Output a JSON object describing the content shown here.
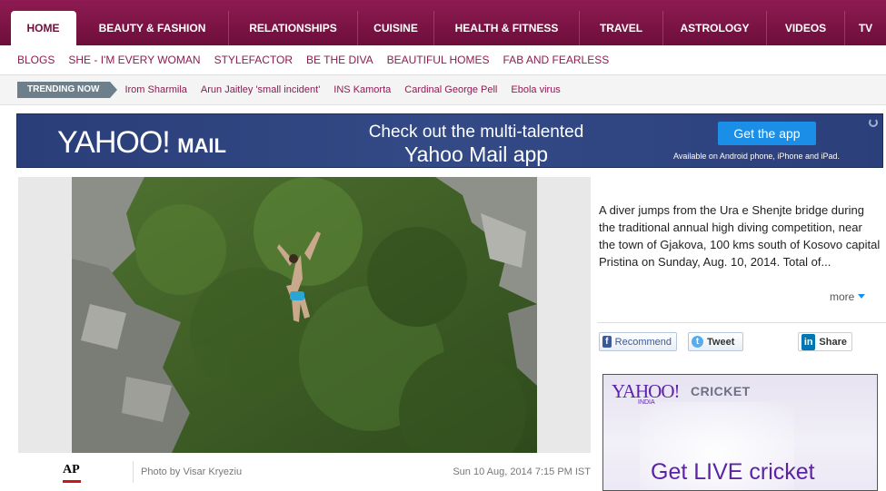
{
  "nav": {
    "tabs": [
      {
        "label": "HOME"
      },
      {
        "label": "BEAUTY & FASHION"
      },
      {
        "label": "RELATIONSHIPS"
      },
      {
        "label": "CUISINE"
      },
      {
        "label": "HEALTH & FITNESS"
      },
      {
        "label": "TRAVEL"
      },
      {
        "label": "ASTROLOGY"
      },
      {
        "label": "VIDEOS"
      },
      {
        "label": "TV"
      }
    ],
    "subnav": [
      "BLOGS",
      "SHE - I'M EVERY WOMAN",
      "STYLEFACTOR",
      "BE THE DIVA",
      "BEAUTIFUL HOMES",
      "FAB AND FEARLESS"
    ]
  },
  "trending": {
    "label": "TRENDING NOW",
    "items": [
      "Irom Sharmila",
      "Arun Jaitley 'small incident'",
      "INS Kamorta",
      "Cardinal George Pell",
      "Ebola virus"
    ]
  },
  "banner": {
    "logo_yahoo": "YAHOO!",
    "logo_mail": "MAIL",
    "headline_1": "Check out the multi-talented",
    "headline_2": "Yahoo Mail app",
    "cta": "Get the app",
    "availability": "Available on Android phone, iPhone and iPad."
  },
  "photo": {
    "source": "AP",
    "credit": "Photo by Visar Kryeziu",
    "timestamp": "Sun 10 Aug, 2014 7:15 PM IST"
  },
  "caption": {
    "text": "A diver jumps from the Ura e Shenjte bridge during the traditional annual high diving competition, near the town of Gjakova, 100 kms south of Kosovo capital Pristina on Sunday, Aug. 10, 2014. Total of...",
    "more": "more"
  },
  "share": {
    "recommend": "Recommend",
    "tweet": "Tweet",
    "share": "Share"
  },
  "ad": {
    "logo": "YAHOO!",
    "logo_sub": "INDIA",
    "product": "CRICKET",
    "tagline": "Get LIVE cricket"
  },
  "colors": {
    "brand": "#8e1b52",
    "nav_dark": "#6d0e3b",
    "trending_badge": "#6e7f8c",
    "banner_bg": "#2f4480",
    "cta_blue": "#1b8fe8",
    "yahoo_purple": "#5b24a6"
  }
}
